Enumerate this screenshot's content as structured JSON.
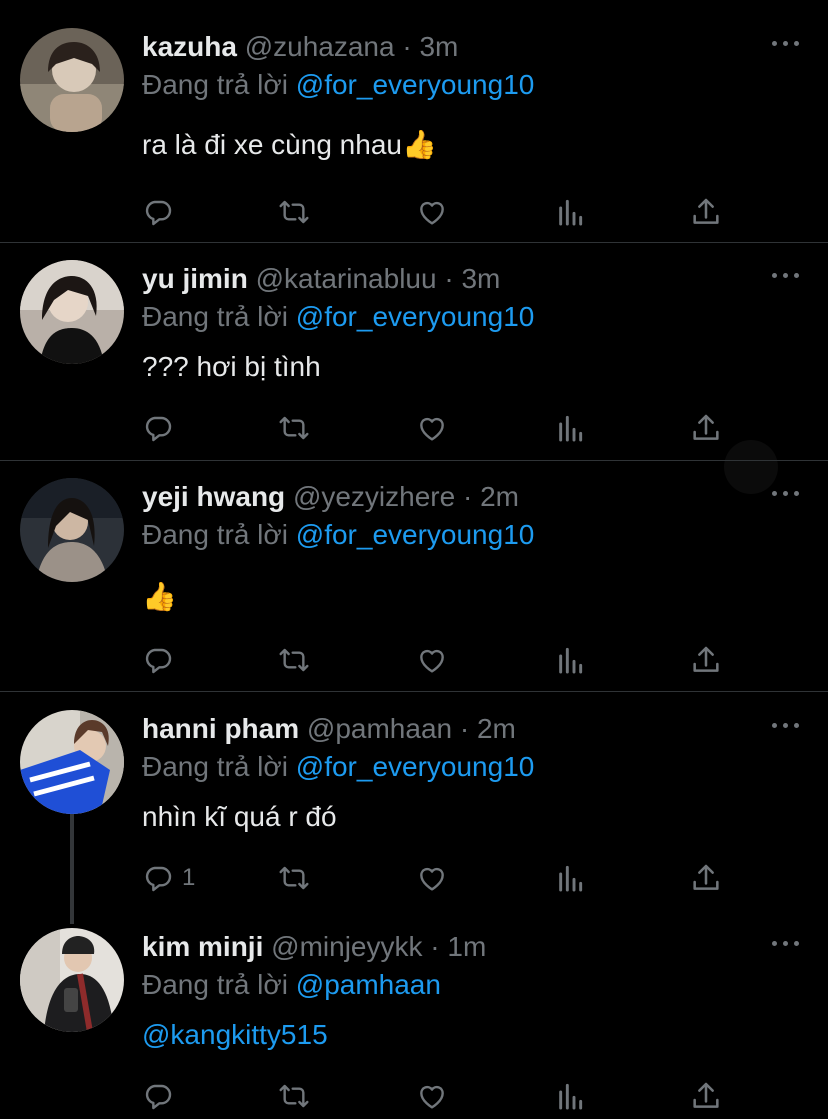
{
  "tweets": [
    {
      "name": "kazuha",
      "handle": "@zuhazana",
      "dot": "·",
      "time": "3m",
      "reply_prefix": "Đang trả lời",
      "reply_to": "@for_everyoung10",
      "text": "ra là đi xe cùng nhau👍",
      "reply_count": ""
    },
    {
      "name": "yu jimin",
      "handle": "@katarinabluu",
      "dot": "·",
      "time": "3m",
      "reply_prefix": "Đang trả lời",
      "reply_to": "@for_everyoung10",
      "text": "??? hơi bị tình",
      "reply_count": ""
    },
    {
      "name": "yeji hwang",
      "handle": "@yezyizhere",
      "dot": "·",
      "time": "2m",
      "reply_prefix": "Đang trả lời",
      "reply_to": "@for_everyoung10",
      "text": "👍",
      "reply_count": ""
    },
    {
      "name": "hanni pham",
      "handle": "@pamhaan",
      "dot": "·",
      "time": "2m",
      "reply_prefix": "Đang trả lời",
      "reply_to": "@for_everyoung10",
      "text": "nhìn kĩ quá r đó",
      "reply_count": "1"
    },
    {
      "name": "kim minji",
      "handle": "@minjeyykk",
      "dot": "·",
      "time": "1m",
      "reply_prefix": "Đang trả lời",
      "reply_to": "@pamhaan",
      "text": "@kangkitty515",
      "reply_count": ""
    }
  ],
  "icons": {
    "reply": "reply-icon",
    "retweet": "retweet-icon",
    "like": "heart-icon",
    "views": "views-icon",
    "share": "share-icon",
    "more": "more-icon"
  },
  "colors": {
    "background": "#000000",
    "text": "#e7e9ea",
    "muted": "#71767b",
    "accent": "#1d9bf0",
    "divider": "#2f3336"
  }
}
